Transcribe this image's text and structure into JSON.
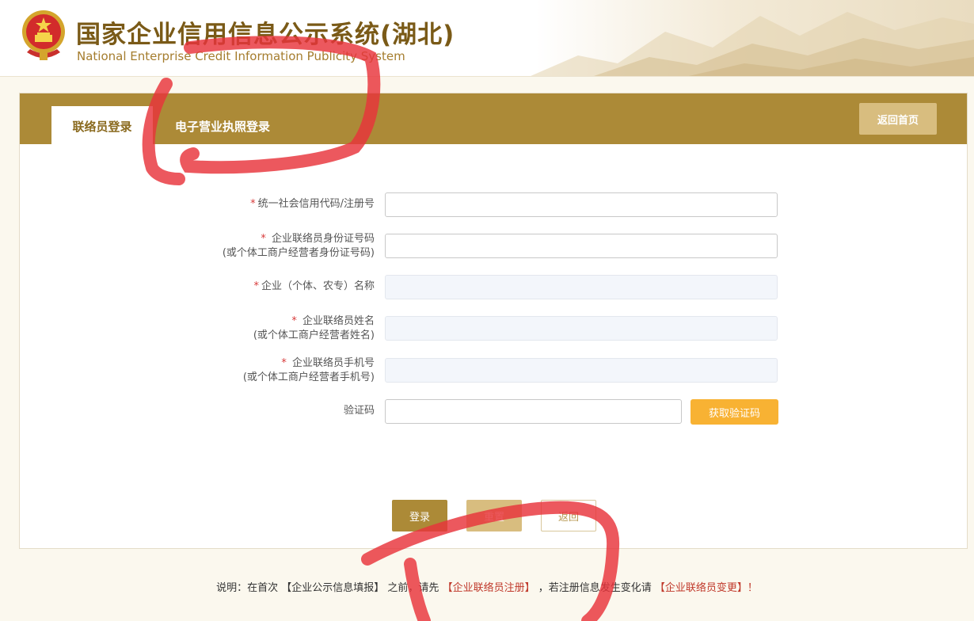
{
  "header": {
    "title_cn": "国家企业信用信息公示系统(湖北)",
    "title_en": "National Enterprise Credit Information Publicity System"
  },
  "tabs": [
    {
      "label": "联络员登录",
      "active": true
    },
    {
      "label": "电子营业执照登录",
      "active": false
    }
  ],
  "back_home_label": "返回首页",
  "form": {
    "required_mark": "*",
    "credit_code": {
      "label": "统一社会信用代码/注册号",
      "value": ""
    },
    "id_number": {
      "label": "企业联络员身份证号码",
      "sublabel": "(或个体工商户经营者身份证号码)",
      "value": ""
    },
    "company_name": {
      "label": "企业（个体、农专）名称",
      "value": ""
    },
    "contact_name": {
      "label": "企业联络员姓名",
      "sublabel": "(或个体工商户经营者姓名)",
      "value": ""
    },
    "mobile": {
      "label": "企业联络员手机号",
      "sublabel": "(或个体工商户经营者手机号)",
      "value": ""
    },
    "captcha": {
      "label": "验证码",
      "value": ""
    },
    "get_code_label": "获取验证码"
  },
  "buttons": {
    "login": "登录",
    "reset": "重置",
    "back": "返回"
  },
  "note": {
    "prefix": "说明：在首次",
    "bracket1": "【企业公示信息填报】",
    "mid1": "之前，请先",
    "link1": "【企业联络员注册】",
    "mid2": "，若注册信息发生变化请",
    "link2": "【企业联络员变更】",
    "suffix": "！"
  },
  "colors": {
    "brand": "#ac8a37",
    "title": "#7a5a17",
    "accent_orange": "#f8b233",
    "link": "#c0392b",
    "marker": "#e8333a"
  }
}
